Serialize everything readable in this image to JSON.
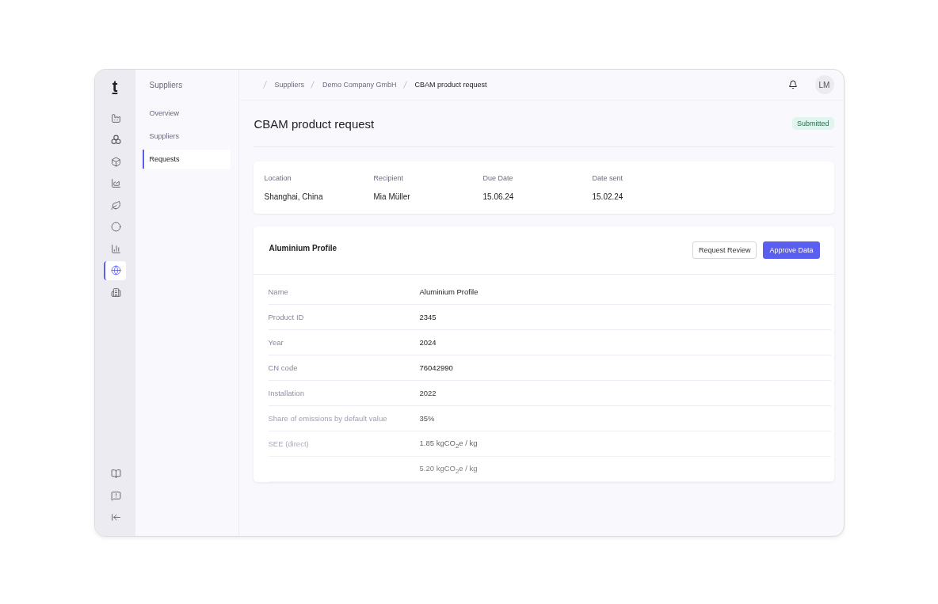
{
  "logo": "t",
  "rail": {
    "items": [
      {
        "kind": "factory",
        "selected": false
      },
      {
        "kind": "circles",
        "selected": false
      },
      {
        "kind": "box",
        "selected": false
      },
      {
        "kind": "chart",
        "selected": false
      },
      {
        "kind": "leaf",
        "selected": false
      },
      {
        "kind": "circle",
        "selected": false
      },
      {
        "kind": "bars",
        "selected": false
      },
      {
        "kind": "globe",
        "selected": true
      },
      {
        "kind": "building",
        "selected": false
      }
    ],
    "bottom": [
      {
        "kind": "book"
      },
      {
        "kind": "feedback"
      },
      {
        "kind": "collapse"
      }
    ]
  },
  "subnav": {
    "title": "Suppliers",
    "items": [
      {
        "label": "Overview",
        "selected": false
      },
      {
        "label": "Suppliers",
        "selected": false
      },
      {
        "label": "Requests",
        "selected": true
      }
    ]
  },
  "breadcrumbs": [
    {
      "label": "Suppliers",
      "current": false
    },
    {
      "label": "Demo Company GmbH",
      "current": false
    },
    {
      "label": "CBAM product request",
      "current": true
    }
  ],
  "user": {
    "initials": "LM"
  },
  "page": {
    "title": "CBAM product request",
    "status": "Submitted"
  },
  "summary": [
    {
      "label": "Location",
      "value": "Shanghai, China"
    },
    {
      "label": "Recipient",
      "value": "Mia Müller"
    },
    {
      "label": "Due Date",
      "value": "15.06.24"
    },
    {
      "label": "Date sent",
      "value": "15.02.24"
    }
  ],
  "product": {
    "title": "Aluminium Profile",
    "buttons": [
      {
        "label": "Request Review",
        "kind": "secondary"
      },
      {
        "label": "Approve Data",
        "kind": "primary"
      }
    ],
    "rows": [
      {
        "label": "Name",
        "value": "Aluminium Profile"
      },
      {
        "label": "Product ID",
        "value": "2345"
      },
      {
        "label": "Year",
        "value": "2024"
      },
      {
        "label": "CN code",
        "value": "76042990"
      },
      {
        "label": "Installation",
        "value": "2022"
      },
      {
        "label": "Share of emissions by default value",
        "value": "35%"
      },
      {
        "label": "SEE (direct)",
        "value": "1.85 kgCO$_{2}$e / kg"
      },
      {
        "value": "5.20 kgCO$_{2}$e / kg"
      }
    ]
  }
}
